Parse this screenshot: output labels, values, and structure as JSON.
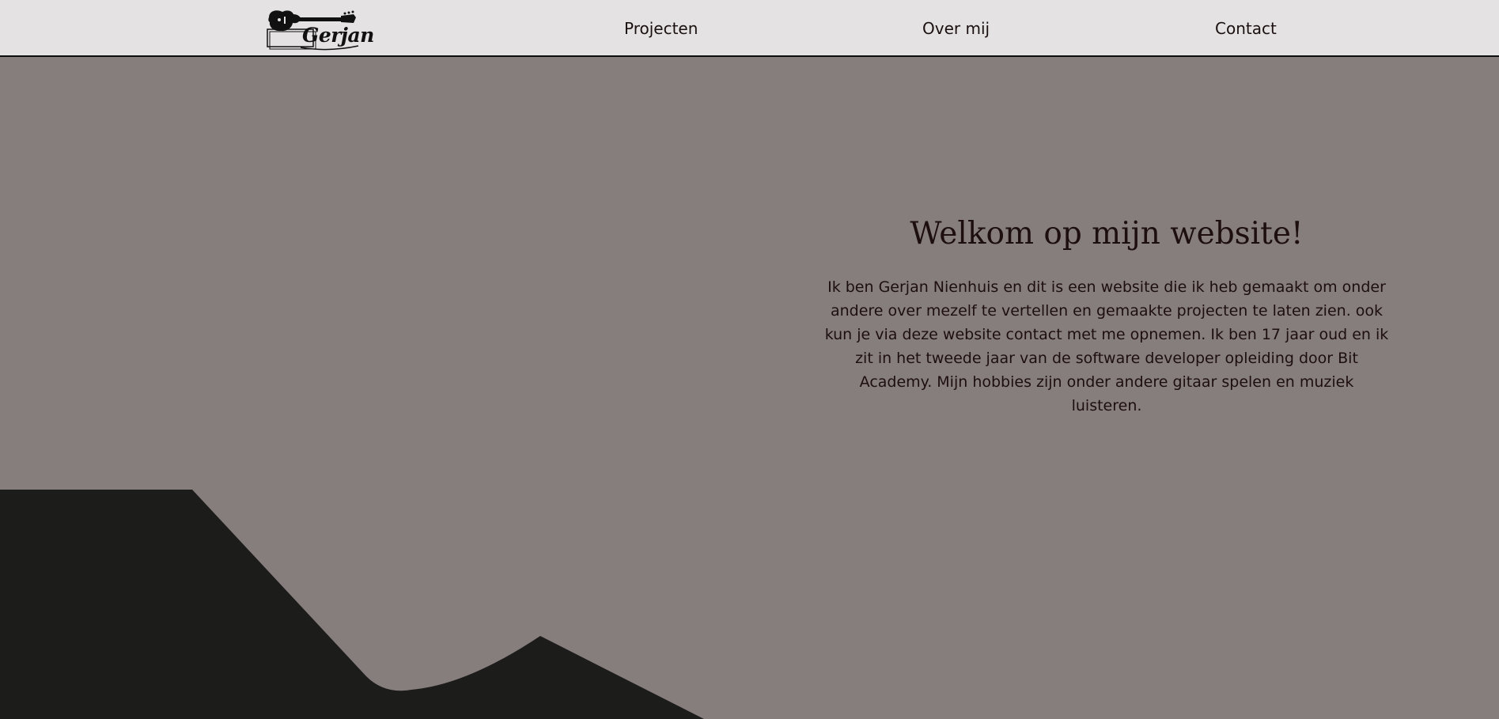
{
  "brand": {
    "logo_text": "Gerjan",
    "logo_icon": "guitar-icon"
  },
  "nav": {
    "items": [
      {
        "label": "Projecten"
      },
      {
        "label": "Over mij"
      },
      {
        "label": "Contact"
      }
    ]
  },
  "hero": {
    "title": "Welkom op mijn website!",
    "body": "Ik ben Gerjan Nienhuis en dit is een website die ik heb gemaakt om onder andere over mezelf te vertellen en gemaakte projecten te laten zien. ook kun je via deze website contact met me opnemen. Ik ben 17 jaar oud en ik zit in het tweede jaar van de software developer opleiding door Bit Academy. Mijn hobbies zijn onder andere gitaar spelen en muziek luisteren."
  },
  "colors": {
    "background": "#867d7d",
    "navbar": "#e4e2e2",
    "mountain": "#1c1c1a",
    "text": "#1e0f0f"
  }
}
